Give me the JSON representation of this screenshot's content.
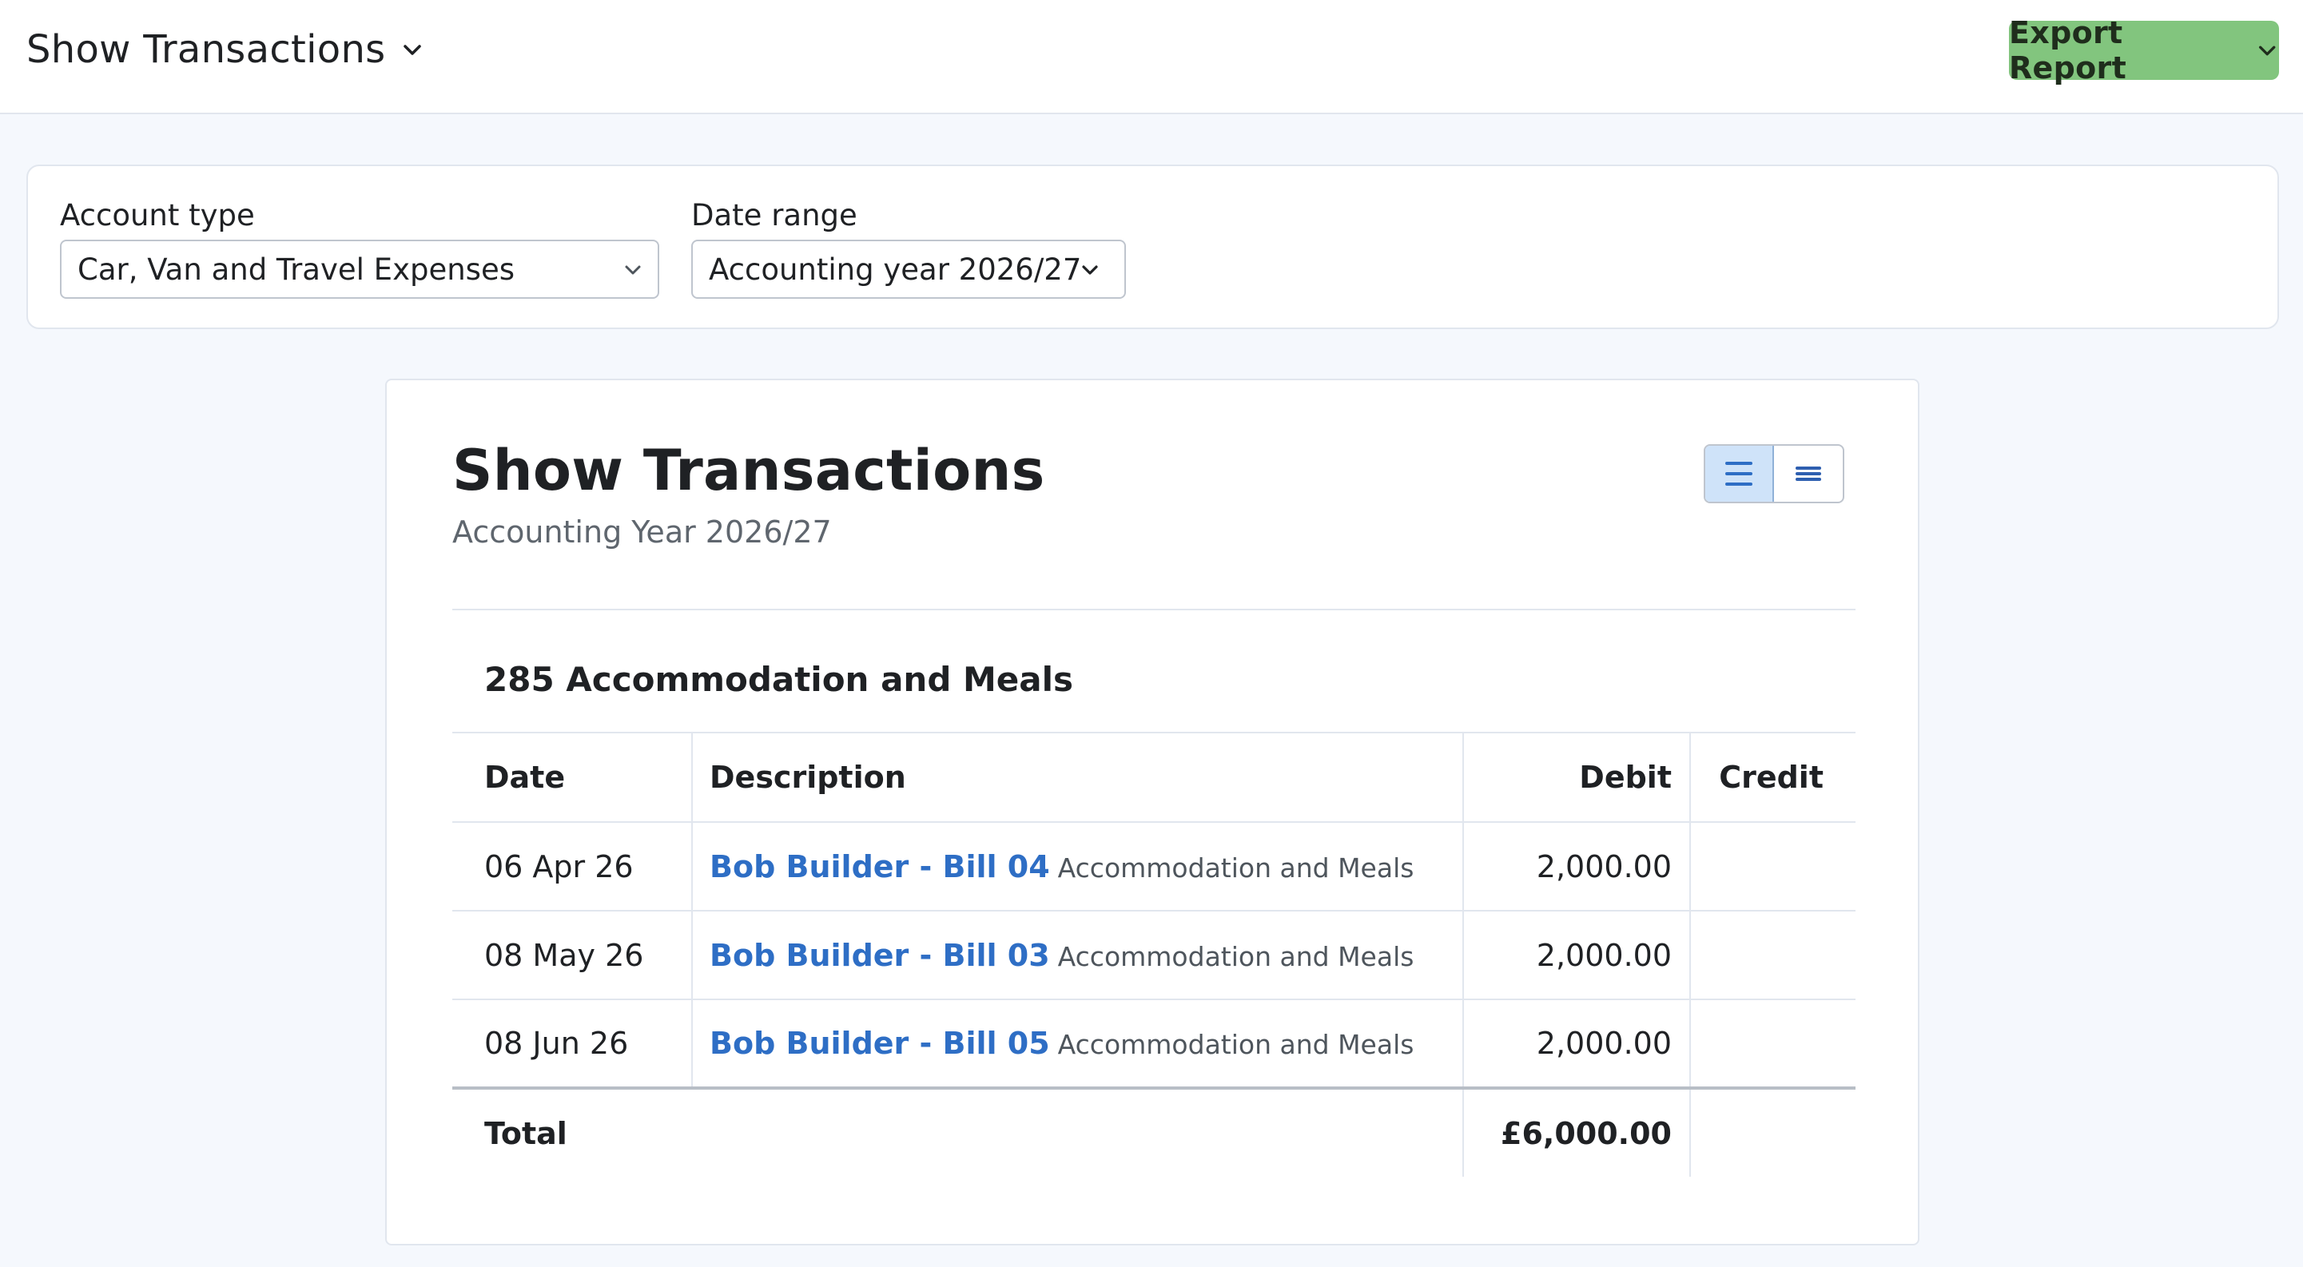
{
  "header": {
    "title": "Show Transactions",
    "export_label": "Export Report"
  },
  "filters": {
    "account_type": {
      "label": "Account type",
      "value": "Car, Van and Travel Expenses"
    },
    "date_range": {
      "label": "Date range",
      "value": "Accounting year 2026/27"
    }
  },
  "report": {
    "title": "Show Transactions",
    "subtitle": "Accounting Year 2026/27",
    "section": "285 Accommodation and Meals",
    "columns": {
      "date": "Date",
      "description": "Description",
      "debit": "Debit",
      "credit": "Credit"
    },
    "rows": [
      {
        "date": "06 Apr 26",
        "link": "Bob Builder - Bill 04",
        "category": "Accommodation and Meals",
        "debit": "2,000.00",
        "credit": ""
      },
      {
        "date": "08 May 26",
        "link": "Bob Builder - Bill 03",
        "category": "Accommodation and Meals",
        "debit": "2,000.00",
        "credit": ""
      },
      {
        "date": "08 Jun 26",
        "link": "Bob Builder - Bill 05",
        "category": "Accommodation and Meals",
        "debit": "2,000.00",
        "credit": ""
      }
    ],
    "total": {
      "label": "Total",
      "debit": "£6,000.00",
      "credit": ""
    }
  },
  "icons": {
    "title_dropdown": "chevron-down-icon",
    "export_dropdown": "chevron-down-icon",
    "select_dropdown": "chevron-down-icon",
    "view_detailed": "list-detailed-icon",
    "view_compact": "list-compact-icon"
  },
  "colors": {
    "export_button": "#82c57e",
    "link": "#2e6ec5",
    "toggle_active": "#cfe3f9",
    "page_background": "#f5f8fd"
  }
}
